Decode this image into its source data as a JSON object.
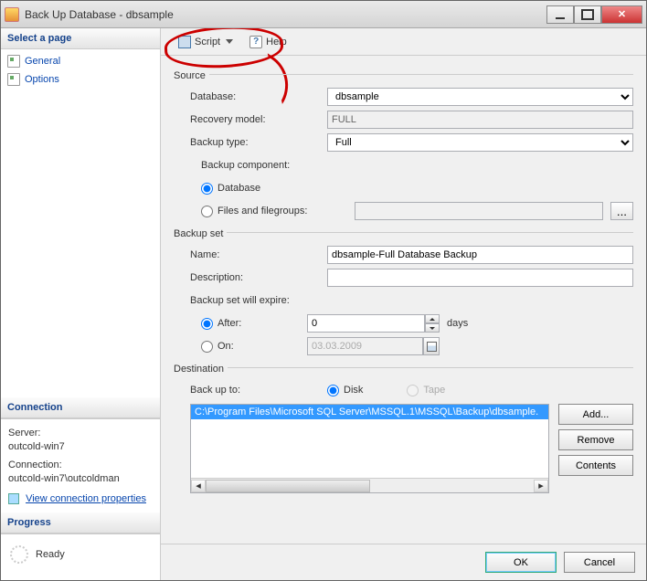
{
  "window": {
    "title": "Back Up Database - dbsample"
  },
  "sidebar": {
    "select_page": "Select a page",
    "pages": {
      "general": "General",
      "options": "Options"
    },
    "connection": {
      "header": "Connection",
      "server_lbl": "Server:",
      "server_val": "outcold-win7",
      "conn_lbl": "Connection:",
      "conn_val": "outcold-win7\\outcoldman",
      "view_link": "View connection properties"
    },
    "progress": {
      "header": "Progress",
      "status": "Ready"
    }
  },
  "toolbar": {
    "script": "Script",
    "help": "Help"
  },
  "source": {
    "header": "Source",
    "database_lbl": "Database:",
    "database_val": "dbsample",
    "recovery_lbl": "Recovery model:",
    "recovery_val": "FULL",
    "backup_type_lbl": "Backup type:",
    "backup_type_val": "Full",
    "component_lbl": "Backup component:",
    "database_radio": "Database",
    "files_radio": "Files and filegroups:"
  },
  "backupset": {
    "header": "Backup set",
    "name_lbl": "Name:",
    "name_val": "dbsample-Full Database Backup",
    "desc_lbl": "Description:",
    "desc_val": "",
    "expire_lbl": "Backup set will expire:",
    "after_lbl": "After:",
    "after_val": "0",
    "after_unit": "days",
    "on_lbl": "On:",
    "on_val": "03.03.2009"
  },
  "destination": {
    "header": "Destination",
    "backup_to_lbl": "Back up to:",
    "disk": "Disk",
    "tape": "Tape",
    "path": "C:\\Program Files\\Microsoft SQL Server\\MSSQL.1\\MSSQL\\Backup\\dbsample.",
    "add": "Add...",
    "remove": "Remove",
    "contents": "Contents"
  },
  "footer": {
    "ok": "OK",
    "cancel": "Cancel"
  }
}
